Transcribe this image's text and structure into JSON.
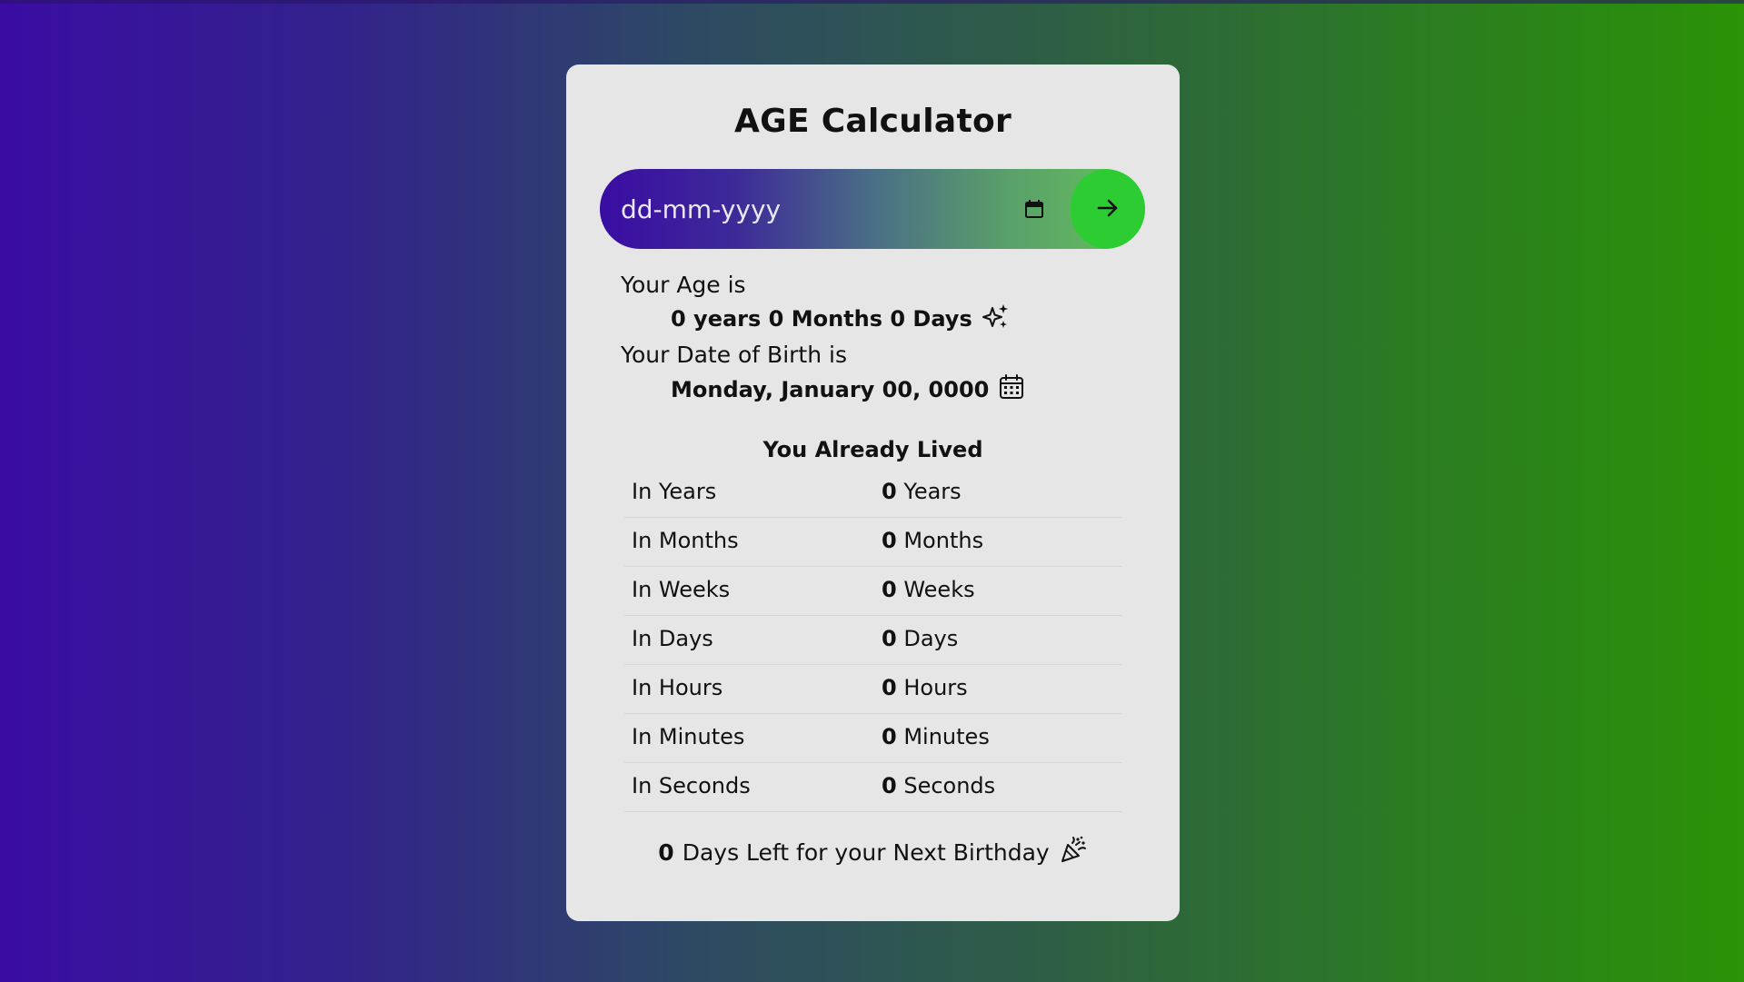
{
  "app": {
    "title": "AGE Calculator"
  },
  "input": {
    "placeholder": "dd-mm-yyyy"
  },
  "age": {
    "label": "Your Age is",
    "value": "0 years 0 Months 0 Days"
  },
  "dob": {
    "label": "Your Date of Birth is",
    "value": "Monday, January 00, 0000"
  },
  "lived": {
    "heading": "You Already Lived",
    "rows": [
      {
        "label": "In Years",
        "value": "0",
        "unit": "Years"
      },
      {
        "label": "In Months",
        "value": "0",
        "unit": "Months"
      },
      {
        "label": "In Weeks",
        "value": "0",
        "unit": "Weeks"
      },
      {
        "label": "In Days",
        "value": "0",
        "unit": "Days"
      },
      {
        "label": "In Hours",
        "value": "0",
        "unit": "Hours"
      },
      {
        "label": "In Minutes",
        "value": "0",
        "unit": "Minutes"
      },
      {
        "label": "In Seconds",
        "value": "0",
        "unit": "Seconds"
      }
    ]
  },
  "birthday": {
    "count": "0",
    "text": "Days Left for your Next Birthday"
  },
  "icons": {
    "calendar_picker": "calendar-icon",
    "submit": "arrow-right-icon",
    "age": "sparkles-icon",
    "dob": "calendar-days-icon",
    "birthday": "party-popper-icon"
  },
  "colors": {
    "accent_green": "#2ecc33",
    "gradient_start": "#3a0ca3",
    "gradient_end": "#2a9306",
    "card": "#e6e6e6"
  }
}
